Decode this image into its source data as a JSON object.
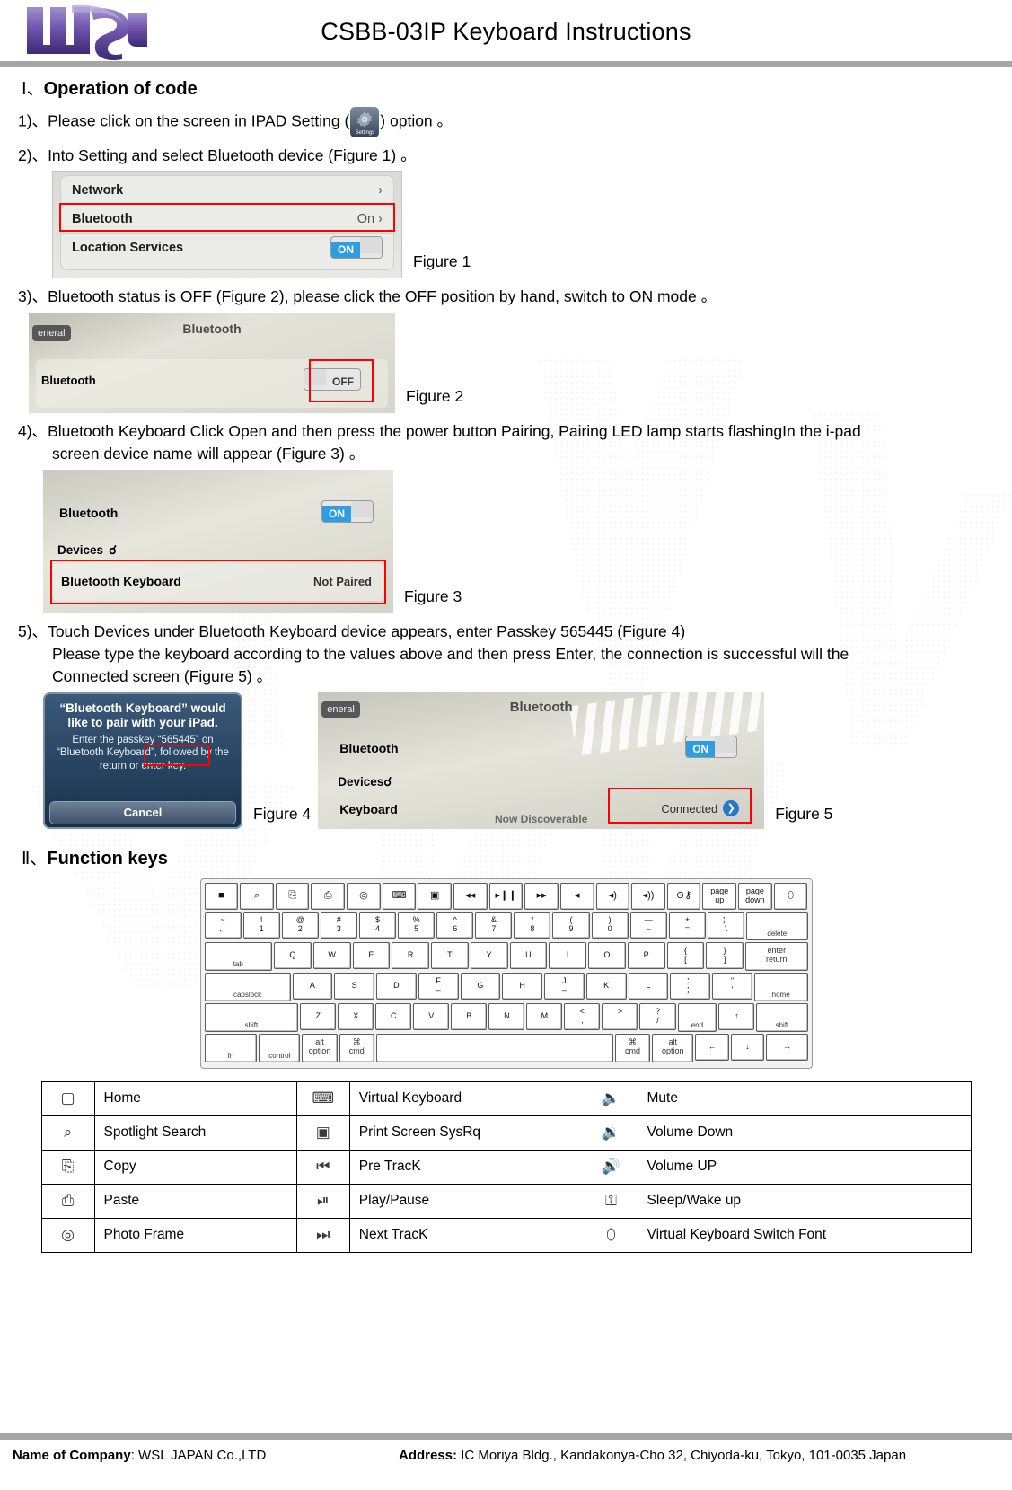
{
  "header": {
    "title": "CSBB-03IP Keyboard Instructions",
    "logo_alt": "WSL logo"
  },
  "section1": {
    "numeral": "Ⅰ、",
    "title": "Operation of code",
    "steps": [
      {
        "num": "1)、",
        "text_before": "Please click on the screen in IPAD Setting (",
        "icon_label": "Settings",
        "text_after": ") option 。"
      },
      {
        "num": "2)、",
        "text": "Into Setting and select Bluetooth device (Figure 1) 。"
      },
      {
        "num": "3)、",
        "text": "Bluetooth status is OFF (Figure 2), please click the OFF position by hand, switch to ON mode 。"
      },
      {
        "num": "4)、",
        "text": "Bluetooth Keyboard Click Open and then press the power button Pairing, Pairing LED lamp starts flashingIn the i-pad",
        "text2": "screen device name will appear (Figure 3) 。"
      },
      {
        "num": "5)、",
        "text": "Touch Devices under Bluetooth Keyboard device appears, enter Passkey 565445 (Figure 4)",
        "text2": "Please type the keyboard according to the values above and then press Enter, the connection is successful will the",
        "text3": "Connected screen (Figure 5) 。"
      }
    ]
  },
  "figures": {
    "fig1": {
      "caption": "Figure 1",
      "rows": [
        {
          "label": "Network",
          "value": "",
          "chevron": "›"
        },
        {
          "label": "Bluetooth",
          "value": "On",
          "chevron": "›"
        },
        {
          "label": "Location Services",
          "value": "ON",
          "chevron": ""
        }
      ]
    },
    "fig2": {
      "caption": "Figure 2",
      "back_button": "eneral",
      "title": "Bluetooth",
      "row_label": "Bluetooth",
      "switch_state": "OFF"
    },
    "fig3": {
      "caption": "Figure 3",
      "row_label": "Bluetooth",
      "switch_state": "ON",
      "devices_label": "Devices",
      "device_name": "Bluetooth Keyboard",
      "device_status": "Not Paired"
    },
    "fig4": {
      "caption": "Figure 4",
      "heading": "“Bluetooth Keyboard” would like to pair with your iPad.",
      "body1": "Enter the passkey",
      "passkey": "“565445”",
      "body2": "on “Bluetooth Keyboard”, followed by the return or enter key.",
      "cancel": "Cancel"
    },
    "fig5": {
      "caption": "Figure 5",
      "back_button": "eneral",
      "title": "Bluetooth",
      "row_label": "Bluetooth",
      "switch_state": "ON",
      "devices_label": "Devices",
      "device_name": "Keyboard",
      "device_status": "Connected",
      "discoverable": "Now Discoverable"
    }
  },
  "section2": {
    "numeral": "Ⅱ、",
    "title": "Function keys"
  },
  "keyboard": {
    "row_fn": [
      {
        "icon": "home-icon",
        "glyph": "■",
        "w": 1
      },
      {
        "icon": "search-icon",
        "glyph": "⌕",
        "w": 1
      },
      {
        "icon": "copy-icon",
        "glyph": "⎘",
        "w": 1
      },
      {
        "icon": "paste-icon",
        "glyph": "⎙",
        "w": 1
      },
      {
        "icon": "photo-frame-icon",
        "glyph": "◎",
        "w": 1
      },
      {
        "icon": "virtual-keyboard-icon",
        "glyph": "⌨",
        "w": 1
      },
      {
        "icon": "print-screen-icon",
        "glyph": "▣",
        "w": 1
      },
      {
        "icon": "prev-track-icon",
        "glyph": "◂◂",
        "w": 1
      },
      {
        "icon": "play-pause-icon",
        "glyph": "▸❙❙",
        "w": 1
      },
      {
        "icon": "next-track-icon",
        "glyph": "▸▸",
        "w": 1
      },
      {
        "icon": "mute-icon",
        "glyph": "◂",
        "w": 1
      },
      {
        "icon": "volume-down-icon",
        "glyph": "◂)",
        "w": 1
      },
      {
        "icon": "volume-up-icon",
        "glyph": "◂))",
        "w": 1
      },
      {
        "icon": "sleep-wake-icon",
        "glyph": "⊙⚷",
        "w": 1
      },
      {
        "top": "page",
        "bottom": "up",
        "w": 1
      },
      {
        "top": "page",
        "bottom": "down",
        "w": 1
      },
      {
        "icon": "kb-switch-font-icon",
        "glyph": "⬯",
        "w": 1
      }
    ],
    "row_num": [
      {
        "top": "~",
        "bottom": "、",
        "w": 1
      },
      {
        "top": "!",
        "bottom": "1",
        "w": 1
      },
      {
        "top": "@",
        "bottom": "2",
        "w": 1
      },
      {
        "top": "#",
        "bottom": "3",
        "w": 1
      },
      {
        "top": "$",
        "bottom": "4",
        "w": 1
      },
      {
        "top": "%",
        "bottom": "5",
        "w": 1
      },
      {
        "top": "^",
        "bottom": "6",
        "w": 1
      },
      {
        "top": "&",
        "bottom": "7",
        "w": 1
      },
      {
        "top": "*",
        "bottom": "8",
        "w": 1
      },
      {
        "top": "(",
        "bottom": "9",
        "w": 1
      },
      {
        "top": ")",
        "bottom": "0",
        "w": 1
      },
      {
        "top": "—",
        "bottom": "–",
        "w": 1
      },
      {
        "top": "+",
        "bottom": "=",
        "w": 1
      },
      {
        "top": "；",
        "bottom": "\\",
        "w": 1
      },
      {
        "legend": "delete",
        "w": 1.7
      }
    ],
    "row_q": [
      {
        "legend": "tab",
        "w": 1.85
      },
      {
        "top": "Q",
        "w": 1
      },
      {
        "top": "W",
        "w": 1
      },
      {
        "top": "E",
        "w": 1
      },
      {
        "top": "R",
        "w": 1
      },
      {
        "top": "T",
        "w": 1
      },
      {
        "top": "Y",
        "w": 1
      },
      {
        "top": "U",
        "w": 1
      },
      {
        "top": "I",
        "w": 1
      },
      {
        "top": "O",
        "w": 1
      },
      {
        "top": "P",
        "w": 1
      },
      {
        "top": "{",
        "bottom": "[",
        "w": 1
      },
      {
        "top": "}",
        "bottom": "]",
        "w": 1
      },
      {
        "legend2": "enter",
        "legend2b": "return",
        "w": 1.7
      }
    ],
    "row_a": [
      {
        "legend": "capslock",
        "w": 2.2
      },
      {
        "top": "A",
        "w": 1
      },
      {
        "top": "S",
        "w": 1
      },
      {
        "top": "D",
        "w": 1
      },
      {
        "top": "F",
        "bottom": "–",
        "w": 1
      },
      {
        "top": "G",
        "w": 1
      },
      {
        "top": "H",
        "w": 1
      },
      {
        "top": "J",
        "bottom": "–",
        "w": 1
      },
      {
        "top": "K",
        "w": 1
      },
      {
        "top": "L",
        "w": 1
      },
      {
        "top": "：",
        "bottom": "；",
        "w": 1
      },
      {
        "top": "\"",
        "bottom": "'",
        "w": 1
      },
      {
        "legend": "home",
        "w": 1.35
      }
    ],
    "row_z": [
      {
        "legend": "shift",
        "w": 2.7
      },
      {
        "top": "Z",
        "w": 1
      },
      {
        "top": "X",
        "w": 1
      },
      {
        "top": "C",
        "w": 1
      },
      {
        "top": "V",
        "w": 1
      },
      {
        "top": "B",
        "w": 1
      },
      {
        "top": "N",
        "w": 1
      },
      {
        "top": "M",
        "w": 1
      },
      {
        "top": "<",
        "bottom": ",",
        "w": 1
      },
      {
        "top": ">",
        "bottom": ".",
        "w": 1
      },
      {
        "top": "?",
        "bottom": "/",
        "w": 1
      },
      {
        "legend": "end",
        "w": 1.1
      },
      {
        "top": "↑",
        "w": 1
      },
      {
        "legend": "shift",
        "w": 1.45
      }
    ],
    "row_bottom": [
      {
        "legend": "fn",
        "w": 1.6
      },
      {
        "legend": "control",
        "w": 1.25
      },
      {
        "legend2": "alt",
        "legend2b": "option",
        "w": 1.05
      },
      {
        "legend2": "⌘",
        "legend2b": "cmd",
        "w": 1.05
      },
      {
        "legend": "",
        "w": 7.4
      },
      {
        "legend2": "⌘",
        "legend2b": "cmd",
        "w": 1.05
      },
      {
        "legend2": "alt",
        "legend2b": "option",
        "w": 1.25
      },
      {
        "top": "←",
        "w": 1
      },
      {
        "top": "↓",
        "w": 1
      },
      {
        "top": "→",
        "w": 1.25
      }
    ]
  },
  "function_table": [
    [
      {
        "icon": "home-icon",
        "glyph": "▢",
        "label": "Home"
      },
      {
        "icon": "virtual-keyboard-icon",
        "glyph": "⌨",
        "label": "Virtual Keyboard"
      },
      {
        "icon": "mute-icon",
        "glyph": "🔈",
        "label": "Mute"
      }
    ],
    [
      {
        "icon": "spotlight-search-icon",
        "glyph": "⌕",
        "label": "Spotlight Search"
      },
      {
        "icon": "print-screen-icon",
        "glyph": "▣",
        "label": "Print Screen SysRq"
      },
      {
        "icon": "volume-down-icon",
        "glyph": "🔉",
        "label": "Volume Down"
      }
    ],
    [
      {
        "icon": "copy-icon",
        "glyph": "⎘",
        "label": "Copy"
      },
      {
        "icon": "prev-track-icon",
        "glyph": "⏮",
        "label": "Pre TracK"
      },
      {
        "icon": "volume-up-icon",
        "glyph": "🔊",
        "label": "Volume UP"
      }
    ],
    [
      {
        "icon": "paste-icon",
        "glyph": "⎙",
        "label": "Paste"
      },
      {
        "icon": "play-pause-icon",
        "glyph": "⏯",
        "label": "Play/Pause"
      },
      {
        "icon": "sleep-wake-icon",
        "glyph": "⚿",
        "label": "Sleep/Wake up"
      }
    ],
    [
      {
        "icon": "photo-frame-icon",
        "glyph": "◎",
        "label": "Photo Frame"
      },
      {
        "icon": "next-track-icon",
        "glyph": "⏭",
        "label": "Next TracK"
      },
      {
        "icon": "kb-switch-font-icon",
        "glyph": "⬯",
        "label": "Virtual Keyboard Switch Font"
      }
    ]
  ],
  "footer": {
    "company_label": "Name of Company",
    "company_value": ": WSL JAPAN Co.,LTD",
    "address_label": "Address:",
    "address_value": " IC Moriya Bldg., Kandakonya-Cho 32, Chiyoda-ku, Tokyo, 101-0035 Japan"
  }
}
